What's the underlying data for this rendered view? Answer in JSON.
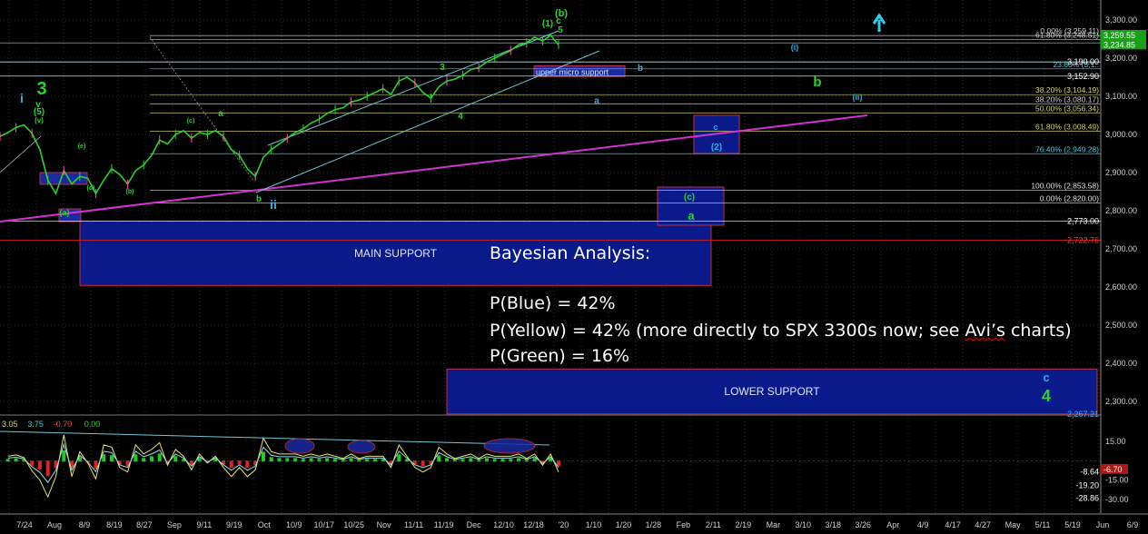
{
  "chart_data": {
    "type": "line",
    "title": "",
    "price_axis": {
      "ylim": [
        2240,
        3320
      ],
      "ticks": [
        "3,300.00",
        "3,200.00",
        "3,100.00",
        "3,000.00",
        "2,900.00",
        "2,800.00",
        "2,700.00",
        "2,600.00",
        "2,500.00",
        "2,400.00",
        "2,300.00"
      ],
      "tick_values": [
        3300,
        3200,
        3100,
        3000,
        2900,
        2800,
        2700,
        2600,
        2500,
        2400,
        2300
      ]
    },
    "x_axis": {
      "labels": [
        "7/24",
        "Aug",
        "8/9",
        "8/19",
        "8/27",
        "Sep",
        "9/11",
        "9/19",
        "Oct",
        "10/9",
        "10/17",
        "10/25",
        "Nov",
        "11/11",
        "11/19",
        "Dec",
        "12/10",
        "12/18",
        "'20",
        "1/10",
        "1/20",
        "1/28",
        "Feb",
        "2/11",
        "2/19",
        "Mar",
        "3/10",
        "3/18",
        "3/26",
        "Apr",
        "4/9",
        "4/17",
        "4/27",
        "May",
        "5/11",
        "5/19",
        "Jun",
        "6/9"
      ]
    },
    "price_tags": [
      {
        "text": "3,259.55",
        "value": 3259.55,
        "color": "#2bd32b"
      },
      {
        "text": "3,234.85",
        "value": 3234.85,
        "color": "#2bd32b"
      },
      {
        "text": "3,190.00",
        "value": 3190,
        "color": "#ffffff"
      },
      {
        "text": "3,152.90",
        "value": 3152.9,
        "color": "#ffffff"
      },
      {
        "text": "2,773.00",
        "value": 2773,
        "color": "#ffffff"
      },
      {
        "text": "2,722.76",
        "value": 2722.76,
        "color": "#ff4040"
      },
      {
        "text": "2,267.21",
        "value": 2267.21,
        "color": "#3fb0ff"
      }
    ],
    "fib_levels": [
      {
        "label": "0.00% (3,259.11)",
        "value": 3259.11,
        "color": "#cfcfcf"
      },
      {
        "label": "61.80% (3,248.51)",
        "value": 3248.51,
        "color": "#cfcfcf"
      },
      {
        "label": "23.60% (3,1..",
        "value": 3172,
        "color": "#4cc8d8"
      },
      {
        "label": "38.20% (3,104.19)",
        "value": 3104.19,
        "color": "#d4d45a"
      },
      {
        "label": "38.20% (3,080.17)",
        "value": 3080.17,
        "color": "#d0d0d0"
      },
      {
        "label": "50.00% (3,056.34)",
        "value": 3056.34,
        "color": "#d4d45a"
      },
      {
        "label": "61.80% (3,008.49)",
        "value": 3008.49,
        "color": "#d4d45a"
      },
      {
        "label": "76.40% (2,949.28)",
        "value": 2949.28,
        "color": "#4cc8d8"
      },
      {
        "label": "100.00% (2,853.58)",
        "value": 2853.58,
        "color": "#e0e0e0"
      },
      {
        "label": "0.00% (2,820.00)",
        "value": 2820,
        "color": "#e0e0e0"
      }
    ],
    "zones": [
      {
        "label": "MAIN SUPPORT",
        "value_top": 2773,
        "value_bottom": 2604
      },
      {
        "label": "LOWER SUPPORT",
        "value_top": 2385,
        "value_bottom": 2267
      },
      {
        "label": "upper micro support",
        "value_top": 3180,
        "value_bottom": 3152
      },
      {
        "label": "",
        "value_top": 3050,
        "value_bottom": 2950
      }
    ],
    "wave_labels": [
      {
        "text": "i",
        "color": "#2fb0e0"
      },
      {
        "text": "3",
        "color": "#2bd32b"
      },
      {
        "text": "v",
        "color": "#2bd32b"
      },
      {
        "text": "(5)",
        "color": "#2bd32b"
      },
      {
        "text": "(v)",
        "color": "#2bd32b"
      },
      {
        "text": "(a)",
        "color": "#2bd32b"
      },
      {
        "text": "(e)",
        "color": "#2bd32b"
      },
      {
        "text": "(c)",
        "color": "#2bd32b"
      },
      {
        "text": "(b)",
        "color": "#2bd32b"
      },
      {
        "text": "(d)",
        "color": "#2bd32b"
      },
      {
        "text": "a",
        "color": "#2bd32b"
      },
      {
        "text": "b",
        "color": "#2bd32b"
      },
      {
        "text": "ii",
        "color": "#2fb0e0"
      },
      {
        "text": "3",
        "color": "#2bd32b"
      },
      {
        "text": "4",
        "color": "#2bd32b"
      },
      {
        "text": "(1)",
        "color": "#2bd32b"
      },
      {
        "text": "c",
        "color": "#2bd32b"
      },
      {
        "text": "5",
        "color": "#2bd32b"
      },
      {
        "text": "b",
        "color": "#2fb0e0"
      },
      {
        "text": "a",
        "color": "#2fb0e0"
      },
      {
        "text": "c",
        "color": "#2fb0e0"
      },
      {
        "text": "(2)",
        "color": "#2fb0e0"
      },
      {
        "text": "(c)",
        "color": "#2bd32b"
      },
      {
        "text": "a",
        "color": "#2bd32b"
      },
      {
        "text": "(i)",
        "color": "#2fb0e0"
      },
      {
        "text": "b",
        "color": "#2bd32b"
      },
      {
        "text": "(ii)",
        "color": "#2fb0e0"
      },
      {
        "text": "c",
        "color": "#2fb0e0"
      },
      {
        "text": "4",
        "color": "#2bd32b"
      }
    ],
    "indicator": {
      "header": [
        {
          "text": "3.05",
          "color": "#d4d45a"
        },
        {
          "text": "3.75",
          "color": "#4cc8d8"
        },
        {
          "text": "-0.70",
          "color": "#ff4040"
        },
        {
          "text": "0.00",
          "color": "#2bd32b"
        }
      ],
      "ticks": [
        "15.00",
        "-15.00",
        "-30.00"
      ],
      "tick_values": [
        15,
        -15,
        -30
      ],
      "ylim": [
        -36,
        24
      ],
      "value_tags": [
        {
          "text": "-8.64",
          "value": -8.64,
          "color": "#ffffff"
        },
        {
          "text": "-6.70",
          "value": -6.7,
          "color": "#ff4040"
        },
        {
          "text": "-19.20",
          "value": -19.2,
          "color": "#ffffff"
        },
        {
          "text": "-28.86",
          "value": -28.86,
          "color": "#ffffff"
        }
      ]
    },
    "close_series": [
      2995,
      3005,
      3018,
      3025,
      3003,
      2960,
      2880,
      2845,
      2905,
      2870,
      2890,
      2885,
      2845,
      2880,
      2910,
      2895,
      2870,
      2905,
      2920,
      2945,
      2985,
      2975,
      3000,
      3010,
      2990,
      3005,
      3000,
      3010,
      2995,
      2960,
      2945,
      2910,
      2890,
      2940,
      2960,
      2975,
      2990,
      3005,
      3015,
      3030,
      3040,
      3055,
      3065,
      3070,
      3085,
      3090,
      3100,
      3110,
      3120,
      3105,
      3140,
      3150,
      3135,
      3110,
      3095,
      3125,
      3140,
      3145,
      3155,
      3170,
      3175,
      3190,
      3200,
      3210,
      3220,
      3235,
      3240,
      3255,
      3245,
      3260,
      3235
    ]
  },
  "annotation": {
    "title": "Bayesian Analysis:",
    "p_blue": "P(Blue) = 42%",
    "p_yellow_before": "P(Yellow) = 42% (more directly to SPX 3300s now; see ",
    "p_yellow_word": "Avi’s",
    "p_yellow_after": " charts)",
    "p_green": "P(Green) = 16%"
  }
}
